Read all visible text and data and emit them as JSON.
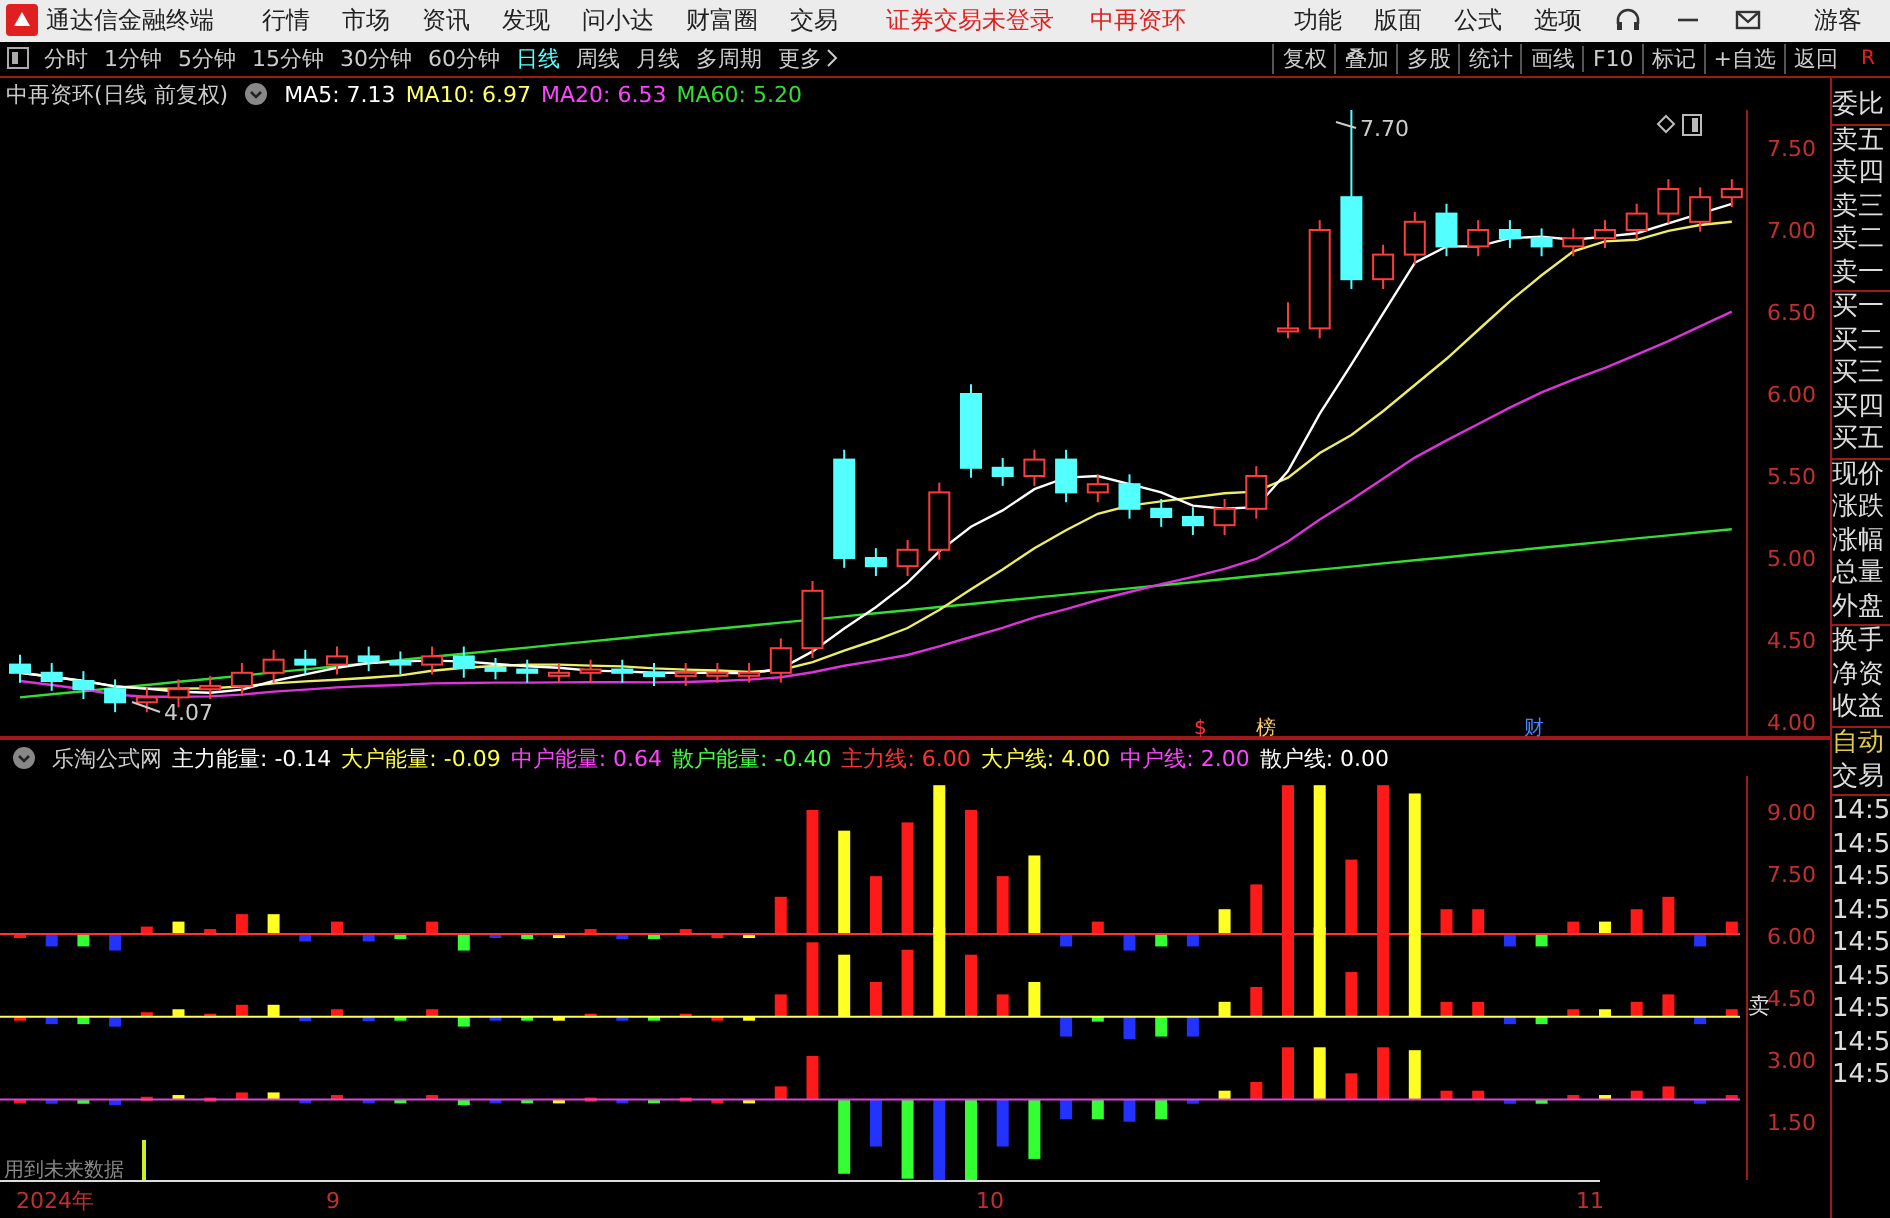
{
  "title_bar": {
    "app_name": "通达信金融终端",
    "menus": [
      "行情",
      "市场",
      "资讯",
      "发现",
      "问小达",
      "财富圈",
      "交易"
    ],
    "status": "证券交易未登录",
    "stock": "中再资环",
    "tools": [
      "功能",
      "版面",
      "公式",
      "选项"
    ],
    "user": "游客"
  },
  "period_bar": {
    "periods": [
      {
        "label": "分时",
        "selected": false
      },
      {
        "label": "1分钟",
        "selected": false
      },
      {
        "label": "5分钟",
        "selected": false
      },
      {
        "label": "15分钟",
        "selected": false
      },
      {
        "label": "30分钟",
        "selected": false
      },
      {
        "label": "60分钟",
        "selected": false
      },
      {
        "label": "日线",
        "selected": true
      },
      {
        "label": "周线",
        "selected": false
      },
      {
        "label": "月线",
        "selected": false
      },
      {
        "label": "多周期",
        "selected": false
      }
    ],
    "more": "更多",
    "actions": [
      "复权",
      "叠加",
      "多股",
      "统计",
      "画线",
      "F10",
      "标记",
      "+自选",
      "返回"
    ],
    "corner": "R"
  },
  "main_chart": {
    "title": "中再资环(日线 前复权)",
    "averages": [
      {
        "label": "MA5: 7.13",
        "color": "#ffffff"
      },
      {
        "label": "MA10: 6.97",
        "color": "#ffff66"
      },
      {
        "label": "MA20: 6.53",
        "color": "#ff44ff"
      },
      {
        "label": "MA60: 5.20",
        "color": "#33dd33"
      }
    ],
    "price_labels": [
      "7.50",
      "7.00",
      "6.50",
      "6.00",
      "5.50",
      "5.00",
      "4.50",
      "4.00"
    ],
    "high_label": "7.70",
    "low_label": "4.07",
    "markers": [
      {
        "text": "$",
        "color": "#ff3333"
      },
      {
        "text": "榜",
        "color": "#ffcc66"
      },
      {
        "text": "财",
        "color": "#4488ff"
      }
    ]
  },
  "indicator": {
    "name": "乐淘公式网",
    "values": [
      {
        "label": "主力能量: -0.14",
        "color": "#ffffff"
      },
      {
        "label": "大户能量: -0.09",
        "color": "#ffff44"
      },
      {
        "label": "中户能量: 0.64",
        "color": "#ff44ff"
      },
      {
        "label": "散户能量: -0.40",
        "color": "#44ff44"
      },
      {
        "label": "主力线: 6.00",
        "color": "#ff3333"
      },
      {
        "label": "大户线: 4.00",
        "color": "#ffff44"
      },
      {
        "label": "中户线: 2.00",
        "color": "#ff44ff"
      },
      {
        "label": "散户线: 0.00",
        "color": "#ffffff"
      }
    ],
    "axis_labels": [
      "9.00",
      "7.50",
      "6.00",
      "4.50",
      "3.00",
      "1.50"
    ],
    "signal": "卖",
    "note": "用到未来数据"
  },
  "side_panel": {
    "quote_labels": [
      "委比",
      "卖五",
      "卖四",
      "卖三",
      "卖二",
      "卖一",
      "买一",
      "买二",
      "买三",
      "买四",
      "买五",
      "现价",
      "涨跌",
      "涨幅",
      "总量",
      "外盘",
      "换手",
      "净资",
      "收益"
    ],
    "auto": "自动",
    "trade": "交易",
    "times": [
      "14:5",
      "14:5",
      "14:5",
      "14:5",
      "14:5",
      "14:5",
      "14:5",
      "14:5",
      "14:5"
    ]
  },
  "time_axis": {
    "labels": [
      "2024年",
      "9",
      "10",
      "11"
    ]
  }
}
